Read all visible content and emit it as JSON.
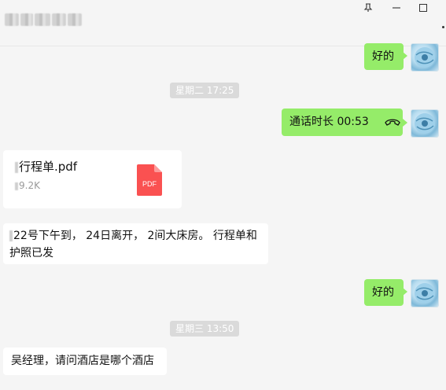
{
  "window": {
    "buttons": {
      "pin": "⊼",
      "minimize": "—",
      "maximize": "□"
    }
  },
  "messages": [
    {
      "side": "me",
      "type": "text",
      "text": "好的"
    },
    {
      "type": "time",
      "text": "星期二 17:25"
    },
    {
      "side": "me",
      "type": "call",
      "text": "通话时长 00:53"
    },
    {
      "side": "other",
      "type": "file",
      "file_name": "行程单.pdf",
      "file_size": "9.2K",
      "file_icon_label": "PDF"
    },
    {
      "side": "other",
      "type": "text",
      "line1": "22号下午到， 24日离开， 2间大床房。 行程单和",
      "line2": "护照已发"
    },
    {
      "side": "me",
      "type": "text",
      "text": "好的"
    },
    {
      "type": "time",
      "text": "星期三 13:50"
    },
    {
      "side": "other",
      "type": "text",
      "text": "吴经理，请问酒店是哪个酒店"
    }
  ],
  "colors": {
    "my_bubble": "#95ec69",
    "other_bubble": "#ffffff",
    "time_tag": "#dadada",
    "background": "#f5f5f5",
    "pdf_icon": "#fa5151"
  },
  "icons": {
    "pin": "pin-icon",
    "minimize": "minimize-icon",
    "maximize": "maximize-icon",
    "call": "handset-icon",
    "file": "pdf-file-icon",
    "avatar": "globe-avatar"
  }
}
